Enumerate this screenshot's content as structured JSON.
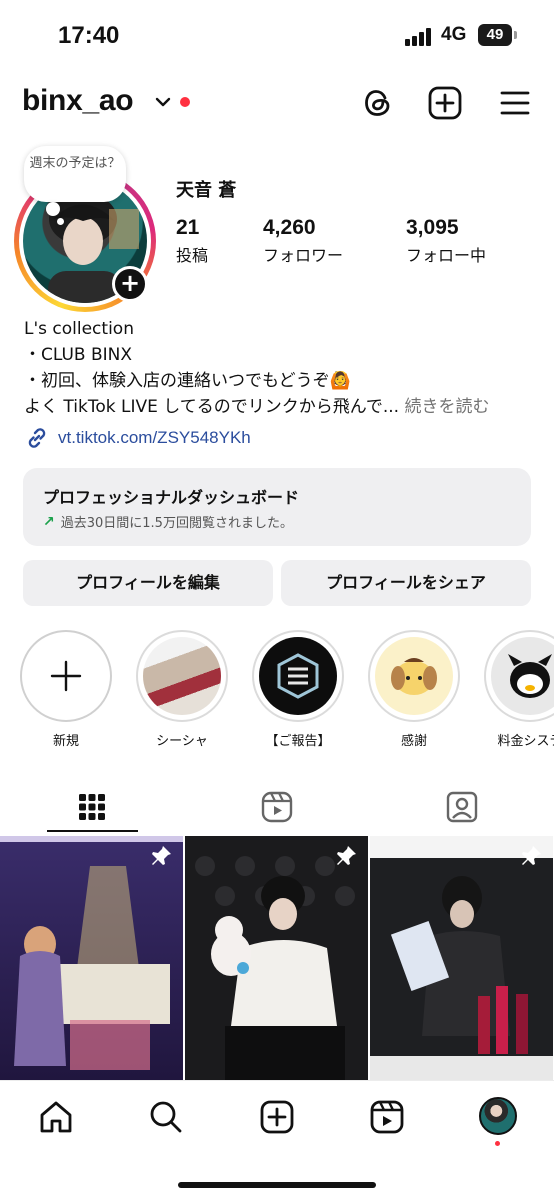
{
  "status_bar": {
    "time": "17:40",
    "network": "4G",
    "battery": "49"
  },
  "header": {
    "username": "binx_ao"
  },
  "profile": {
    "note": "週末の予定は？",
    "display_name": "天音 蒼",
    "stats": [
      {
        "value": "21",
        "label": "投稿"
      },
      {
        "value": "4,260",
        "label": "フォロワー"
      },
      {
        "value": "3,095",
        "label": "フォロー中"
      }
    ],
    "bio": {
      "line1": "L's collection",
      "line2": "・CLUB BINX",
      "line3": "・初回、体験入店の連絡いつでもどうぞ🙆",
      "line4": "よく TikTok LIVE してるのでリンクから飛んで...",
      "more": "続きを読む"
    },
    "link": "vt.tiktok.com/ZSY548YKh"
  },
  "dashboard": {
    "title": "プロフェッショナルダッシュボード",
    "subtitle": "過去30日間に1.5万回閲覧されました。"
  },
  "buttons": {
    "edit": "プロフィールを編集",
    "share": "プロフィールをシェア"
  },
  "highlights": [
    {
      "label": "新規"
    },
    {
      "label": "シーシャ"
    },
    {
      "label": "【ご報告】"
    },
    {
      "label": "感謝"
    },
    {
      "label": "料金システ"
    }
  ],
  "colors": {
    "link": "#2b4d9d",
    "notification": "#ff3040",
    "button_bg": "#efeff1",
    "trend": "#1ba14b"
  }
}
